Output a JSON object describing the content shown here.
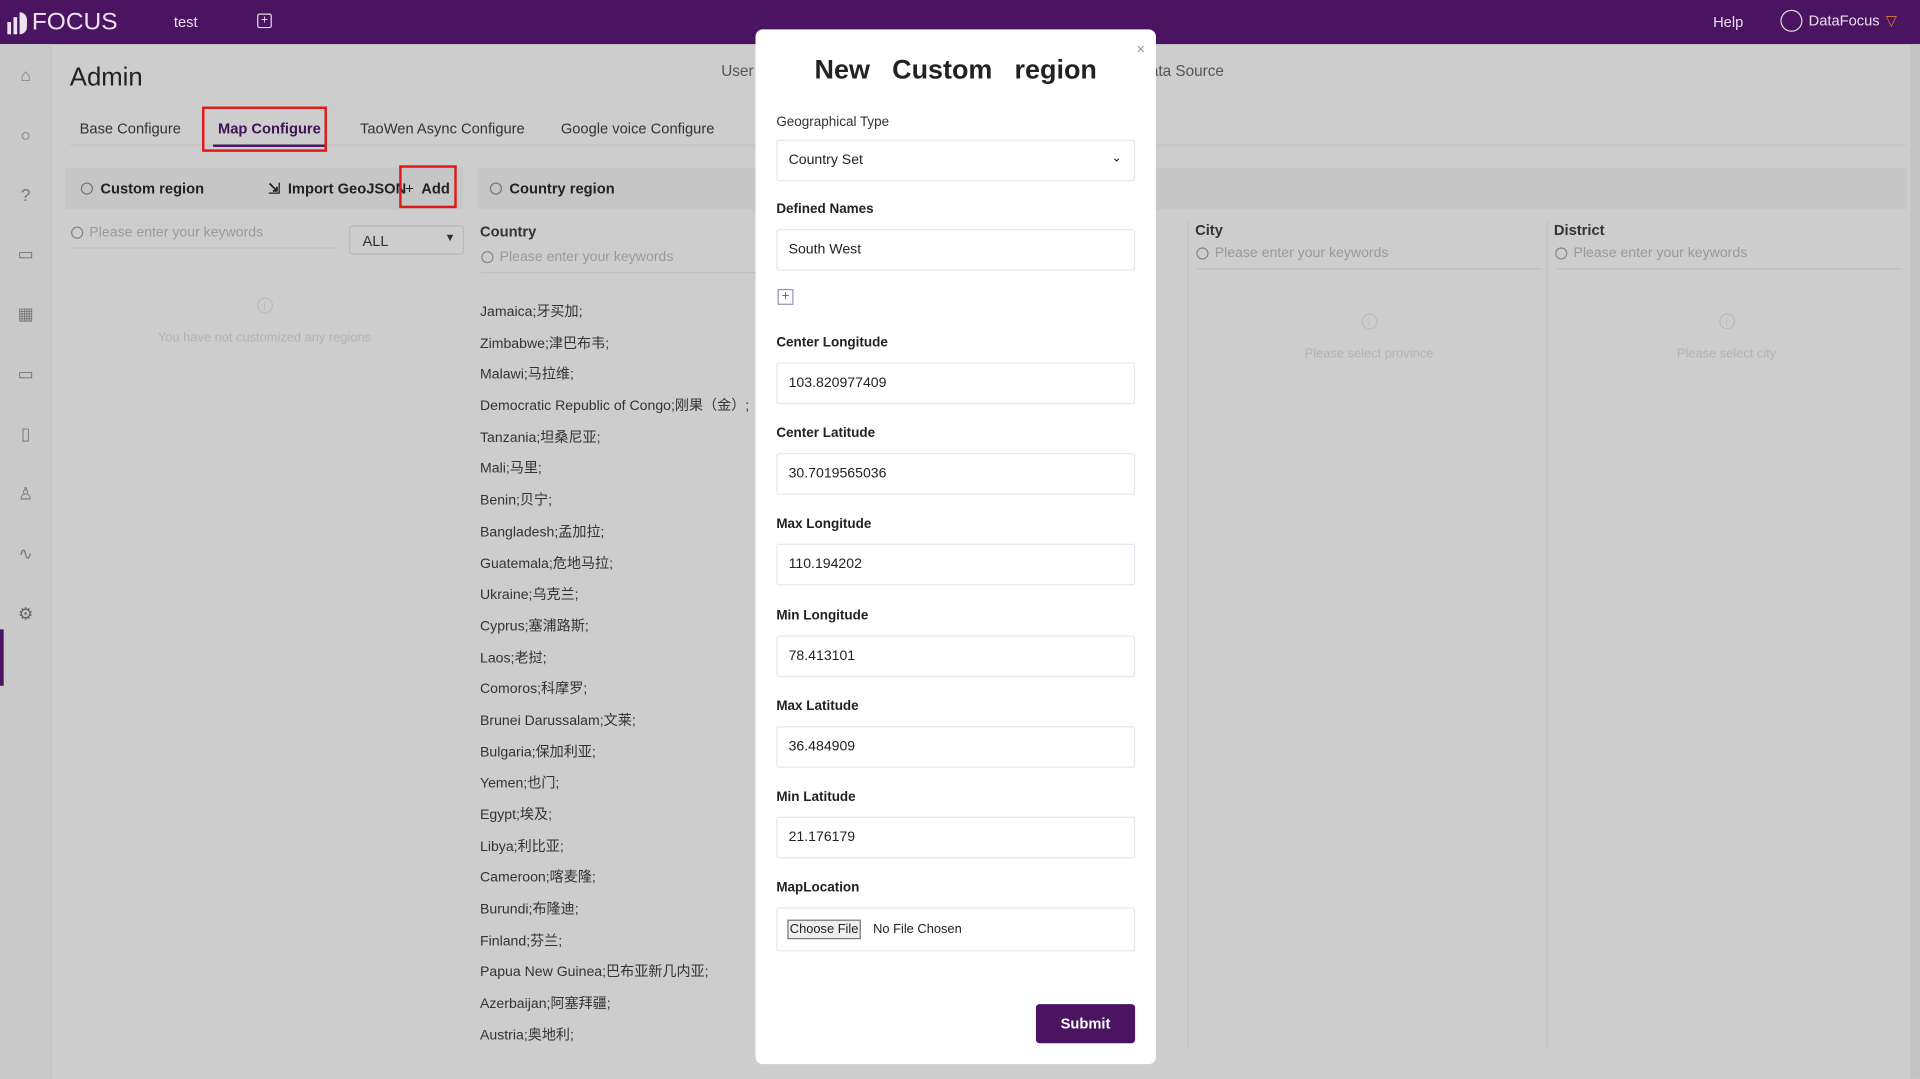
{
  "header": {
    "logo": "FOCUS",
    "tab": "test",
    "help": "Help",
    "user": "DataFocus"
  },
  "sidebar": {
    "icons": [
      "home-icon",
      "search-icon",
      "help-icon",
      "presentation-icon",
      "table-icon",
      "folder-icon",
      "clipboard-icon",
      "user-icon",
      "activity-icon",
      "gear-icon"
    ],
    "active": "gear-icon"
  },
  "page": {
    "title": "Admin",
    "top_tabs": [
      "User",
      "Data Source"
    ]
  },
  "tabs": [
    {
      "label": "Base Configure"
    },
    {
      "label": "Map Configure",
      "active": true
    },
    {
      "label": "TaoWen Async Configure"
    },
    {
      "label": "Google voice Configure"
    }
  ],
  "custom_region": {
    "title": "Custom region",
    "import": "Import GeoJSON",
    "add": "Add",
    "search_placeholder": "Please enter your keywords",
    "filter": "ALL",
    "empty": "You have not customized any regions"
  },
  "country_region": {
    "title": "Country region",
    "country_header": "Country",
    "search_placeholder": "Please enter your keywords",
    "countries": [
      "Jamaica;牙买加;",
      "Zimbabwe;津巴布韦;",
      "Malawi;马拉维;",
      "Democratic Republic of Congo;刚果（金）;",
      "Tanzania;坦桑尼亚;",
      "Mali;马里;",
      "Benin;贝宁;",
      "Bangladesh;孟加拉;",
      "Guatemala;危地马拉;",
      "Ukraine;乌克兰;",
      "Cyprus;塞浦路斯;",
      "Laos;老挝;",
      "Comoros;科摩罗;",
      "Brunei Darussalam;文莱;",
      "Bulgaria;保加利亚;",
      "Yemen;也门;",
      "Egypt;埃及;",
      "Libya;利比亚;",
      "Cameroon;喀麦隆;",
      "Burundi;布隆迪;",
      "Finland;芬兰;",
      "Papua New Guinea;巴布亚新几内亚;",
      "Azerbaijan;阿塞拜疆;",
      "Austria;奥地利;"
    ],
    "city_header": "City",
    "city_placeholder": "Please enter your keywords",
    "city_empty": "Please select province",
    "district_header": "District",
    "district_placeholder": "Please enter your keywords",
    "district_empty": "Please select city"
  },
  "modal": {
    "title": "New Custom region",
    "close": "×",
    "geo_type_label": "Geographical Type",
    "geo_type": "Country Set",
    "defined_names_label": "Defined Names",
    "defined_names": "South West",
    "center_lon_label": "Center Longitude",
    "center_lon": "103.820977409",
    "center_lat_label": "Center Latitude",
    "center_lat": "30.7019565036",
    "max_lon_label": "Max Longitude",
    "max_lon": "110.194202",
    "min_lon_label": "Min Longitude",
    "min_lon": "78.413101",
    "max_lat_label": "Max Latitude",
    "max_lat": "36.484909",
    "min_lat_label": "Min Latitude",
    "min_lat": "21.176179",
    "map_location_label": "MapLocation",
    "choose_file": "Choose File",
    "no_file": "No File Chosen",
    "submit": "Submit"
  },
  "colors": {
    "brand": "#4a1461",
    "highlight": "#e01818"
  }
}
